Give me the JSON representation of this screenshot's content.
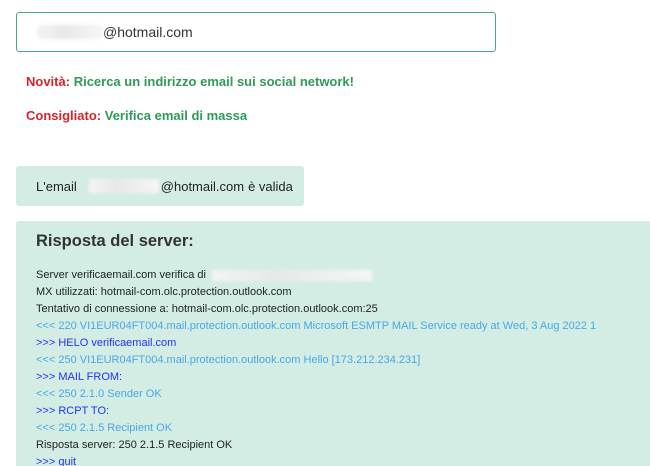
{
  "search": {
    "email_suffix": "@hotmail.com"
  },
  "promo_news": {
    "label": "Novità:",
    "link": "Ricerca un indirizzo email sui social network!"
  },
  "promo_recommended": {
    "label": "Consigliato:",
    "link": "Verifica email di massa"
  },
  "result": {
    "prefix": "L'email",
    "email_suffix": "@hotmail.com",
    "suffix": "è valida"
  },
  "server": {
    "title": "Risposta del server:",
    "lines": [
      {
        "text": "Server verificaemail.com verifica di",
        "color": "black"
      },
      {
        "text": "MX utilizzati: hotmail-com.olc.protection.outlook.com",
        "color": "black"
      },
      {
        "text": "Tentativo di connessione a: hotmail-com.olc.protection.outlook.com:25",
        "color": "black"
      },
      {
        "text": "<<< 220 VI1EUR04FT004.mail.protection.outlook.com Microsoft ESMTP MAIL Service ready at Wed, 3 Aug 2022 1",
        "color": "light"
      },
      {
        "text": ">>> HELO verificaemail.com",
        "color": "blue"
      },
      {
        "text": "<<< 250 VI1EUR04FT004.mail.protection.outlook.com Hello [173.212.234.231]",
        "color": "light"
      },
      {
        "text": ">>> MAIL FROM:",
        "color": "blue"
      },
      {
        "text": "<<< 250 2.1.0 Sender OK",
        "color": "light"
      },
      {
        "text": ">>> RCPT TO:",
        "color": "blue"
      },
      {
        "text": "<<< 250 2.1.5 Recipient OK",
        "color": "light"
      },
      {
        "text": "Risposta server: 250 2.1.5 Recipient OK",
        "color": "black"
      },
      {
        "text": ">>> quit",
        "color": "blue"
      }
    ]
  },
  "colors": {
    "accent_border": "#48a999",
    "box_background": "#d3ede4",
    "label_red": "#d4242b",
    "link_green": "#2f9a57",
    "log_light_blue": "#4aa7e6",
    "log_blue": "#2233ee"
  }
}
